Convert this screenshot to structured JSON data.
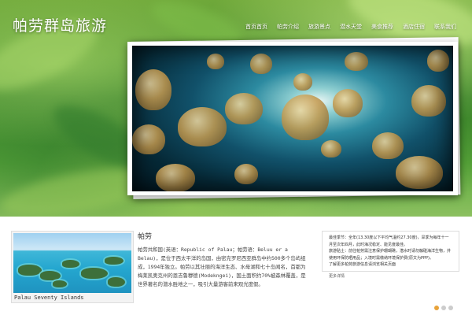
{
  "site": {
    "title": "帕劳群岛旅游"
  },
  "nav": [
    "首页首页",
    "帕劳介绍",
    "旅游景点",
    "潜水天堂",
    "美食推荐",
    "酒店住宿",
    "联系我们"
  ],
  "thumbnail": {
    "caption": "Palau Seventy Islands"
  },
  "article": {
    "heading": "帕劳",
    "body": "帕劳共和国(英语：Republic of Palau；帕劳语：Beluu er a Belau)，是位于西太平洋的岛国，由密克罗尼西亚群岛中约500多个岛屿组成，1994年独立。帕劳以其壮丽的海洋生态、水母湖和七十岛闻名，首都为梅莱凯奥克州的恩吉鲁穆德(Modekngei)，国土面积约70%被森林覆盖，是世界著名的潜水胜地之一，吸引大量游客前来观光度假。"
  },
  "info": {
    "lines": [
      "最佳季节：全年(13.30度以下平均气温约27.30度)，旱季为每年十一月至次年四月，此时海况稳定、能见度最佳。",
      "旅游贴士：前往帕劳需注意保护珊瑚礁，潜水时请勿触碰海洋生物，并使用环保防晒用品；入境时需缴纳环境保护费(原文为PPP)。",
      "了解更多帕劳旅游信息请浏览相关页面"
    ],
    "more": "更多详情"
  },
  "colors": {
    "dot_active": "#e8a33a",
    "dot_inactive": "#cccccc"
  },
  "slider": {
    "total": 3,
    "active": 1
  }
}
